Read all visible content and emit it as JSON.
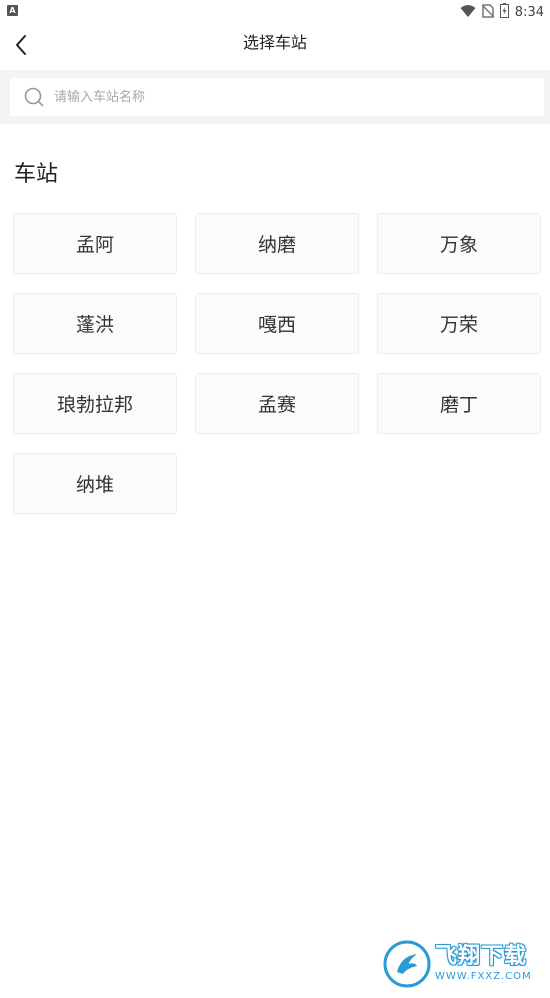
{
  "status_bar": {
    "left_badge": "A",
    "time": "8:34",
    "icons": [
      "wifi-icon",
      "no-sim-icon",
      "battery-icon"
    ]
  },
  "header": {
    "title": "选择车站",
    "back_icon": "chevron-left-icon"
  },
  "search": {
    "placeholder": "请输入车站名称",
    "value": "",
    "icon": "search-icon"
  },
  "section": {
    "title": "车站"
  },
  "stations": [
    "孟阿",
    "纳磨",
    "万象",
    "蓬洪",
    "嘎西",
    "万荣",
    "琅勃拉邦",
    "孟赛",
    "磨丁",
    "纳堆"
  ],
  "watermark": {
    "brand": "飞翔下载",
    "url": "WWW.FXXZ.COM",
    "accent_color": "#2a9ad6"
  }
}
